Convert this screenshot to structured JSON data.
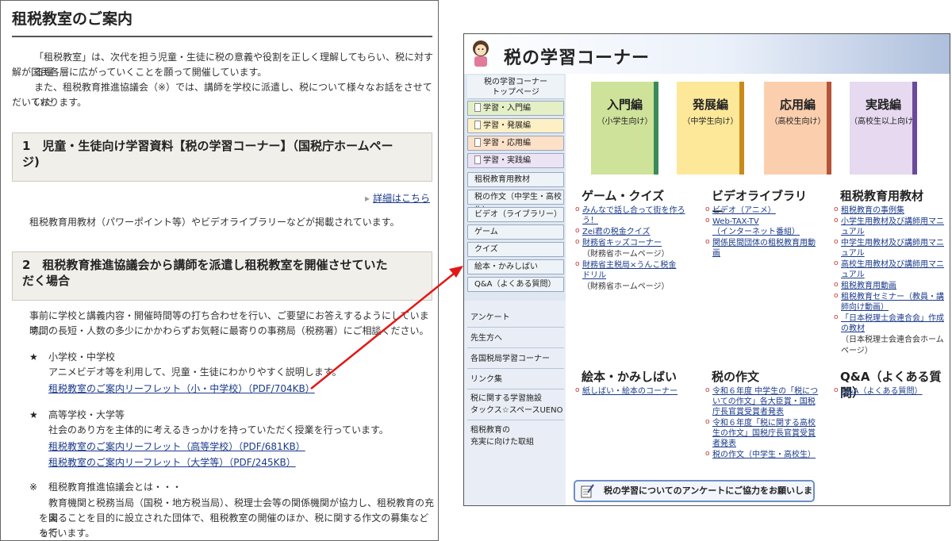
{
  "left": {
    "title": "租税教室のご案内",
    "intro": [
      "「租税教室」は、次代を担う児童・生徒に税の意義や役割を正しく理解してもらい、税に対する理",
      "解が国民各層に広がっていくことを願って開催しています。",
      "また、租税教育推進協議会（※）では、講師を学校に派遣し、税について様々なお話をさせていた",
      "だいております。"
    ],
    "section1": {
      "heading": [
        "1　児童・生徒向け学習資料【税の学習コーナー】（国税庁ホームペー",
        "ジ)"
      ],
      "more_link": "詳細はこちら",
      "body": "租税教育用教材（パワーポイント等）やビデオライブラリーなどが掲載されています。"
    },
    "section2": {
      "heading": [
        "2　租税教育推進協議会から講師を派遣し租税教室を開催させていた",
        "だく場合"
      ],
      "body": [
        "事前に学校と講義内容・開催時間等の打ち合わせを行い、ご要望にお答えするようにしています。",
        "時間の長短・人数の多少にかかわらずお気軽に最寄りの事務局（税務署）にご相談ください。"
      ],
      "items": [
        {
          "mark": "★",
          "label": "小学校・中学校",
          "desc": "アニメビデオ等を利用して、児童・生徒にわかりやすく説明します。",
          "links": [
            "租税教室のご案内リーフレット（小・中学校）（PDF/704KB）"
          ]
        },
        {
          "mark": "★",
          "label": "高等学校・大学等",
          "desc": "社会のあり方を主体的に考えるきっかけを持っていただく授業を行っています。",
          "links": [
            "租税教室のご案内リーフレット（高等学校）（PDF/681KB）",
            "租税教室のご案内リーフレット（大学等）（PDF/245KB）"
          ]
        }
      ],
      "note": {
        "mark": "※",
        "label": "租税教育推進協議会とは・・・",
        "lines": [
          "教育機関と税務当局（国税・地方税当局）、税理士会等の関係機関が協力し、租税教育の充実",
          "を図ることを目的に設立された団体で、租税教室の開催のほか、税に関する作文の募集などを行",
          "っています。"
        ]
      }
    }
  },
  "right": {
    "banner_title": "税の学習コーナー",
    "side_top": [
      "税の学習コーナー",
      "トップページ"
    ],
    "side_books": [
      "学習・入門編",
      "学習・発展編",
      "学習・応用編",
      "学習・実践編"
    ],
    "side_menu": [
      "租税教育用教材",
      "税の作文（中学生・高校生）",
      "ビデオ（ライブラリー）",
      "ゲーム",
      "クイズ",
      "絵本・かみしばい",
      "Q&A（よくある質問）"
    ],
    "side_lower": [
      "アンケート",
      "先生方へ",
      "各国税局学習コーナー",
      "リンク集",
      "税に関する学習施設",
      "タックス☆スペースUENO",
      "租税教育の",
      "充実に向けた取組"
    ],
    "books": [
      {
        "title": "入門編",
        "sub": "（小学生向け）",
        "color": "#cfe29a",
        "spine": "#3a8a5a"
      },
      {
        "title": "発展編",
        "sub": "（中学生向け）",
        "color": "#fde89a",
        "spine": "#c98a1a"
      },
      {
        "title": "応用編",
        "sub": "（高校生向け）",
        "color": "#fbcfae",
        "spine": "#b4543a"
      },
      {
        "title": "実践編",
        "sub": "（高校生以上向け）",
        "color": "#e6d9f0",
        "spine": "#6a4a9a"
      }
    ],
    "cat_game": {
      "title": "ゲーム・クイズ",
      "items": [
        {
          "text": [
            "みんなで話し合って街を作ろ",
            "う！"
          ],
          "note": null
        },
        {
          "text": [
            "Zei君の税金クイズ"
          ],
          "note": null
        },
        {
          "text": [
            "財務省キッズコーナー"
          ],
          "note": "（財務省ホームページ）"
        },
        {
          "text": [
            "財務省主税局×うんこ税金",
            "ドリル"
          ],
          "note": "（財務省ホームページ）"
        }
      ]
    },
    "cat_video": {
      "title": "ビデオライブラリー",
      "items": [
        {
          "text": [
            "ビデオ（アニメ）"
          ],
          "note": null
        },
        {
          "text": [
            "Web-TAX-TV",
            "（インターネット番組）"
          ],
          "note": null
        },
        {
          "text": [
            "関係民間団体の租税教育用動",
            "画"
          ],
          "note": null
        }
      ]
    },
    "cat_material": {
      "title": "租税教育用教材",
      "items": [
        {
          "text": [
            "租税教育の事例集"
          ],
          "note": null
        },
        {
          "text": [
            "小学生用教材及び講師用マニ",
            "ュアル"
          ],
          "note": null
        },
        {
          "text": [
            "中学生用教材及び講師用マニ",
            "ュアル"
          ],
          "note": null
        },
        {
          "text": [
            "高校生用教材及び講師用マニ",
            "ュアル"
          ],
          "note": null
        },
        {
          "text": [
            "租税教育用動画"
          ],
          "note": null
        },
        {
          "text": [
            "租税教育セミナー（教員・講",
            "師向け動画）"
          ],
          "note": null
        },
        {
          "text": [
            "「日本税理士会連合会」作成",
            "の教材"
          ],
          "note": "（日本税理士会連合会ホーム\nページ）"
        }
      ]
    },
    "cat_ehon": {
      "title": "絵本・かみしばい",
      "items": [
        {
          "text": [
            "紙しばい・絵本のコーナー"
          ],
          "note": null
        }
      ]
    },
    "cat_sakubun": {
      "title": "税の作文",
      "items": [
        {
          "text": [
            "令和６年度 中学生の「税につ",
            "いての作文」各大臣賞・国税",
            "庁長官賞受賞者発表"
          ],
          "note": null
        },
        {
          "text": [
            "令和６年度「税に関する高校",
            "生の作文」国税庁長官賞受賞",
            "者発表"
          ],
          "note": null
        },
        {
          "text": [
            "税の作文（中学生・高校生）"
          ],
          "note": null
        }
      ]
    },
    "cat_qa": {
      "title": "Q&A（よくある質問）",
      "items": [
        {
          "text": [
            "Q&A（よくある質問）"
          ],
          "note": null
        }
      ]
    },
    "survey": "税の学習についてのアンケートにご協力をお願いします"
  }
}
